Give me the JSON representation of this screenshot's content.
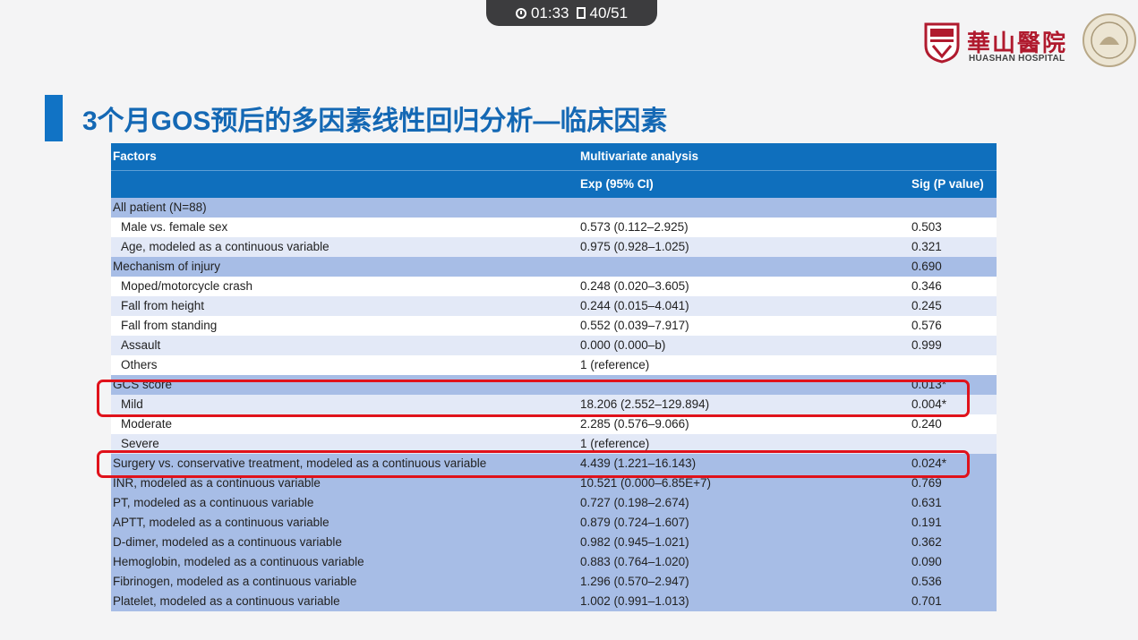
{
  "overlay": {
    "time": "01:33",
    "page": "40/51"
  },
  "logo": {
    "name_cn": "華山醫院",
    "name_en": "HUASHAN HOSPITAL"
  },
  "slide": {
    "title": "3个月GOS预后的多因素线性回归分析—临床因素"
  },
  "table": {
    "header": {
      "factors": "Factors",
      "group": "Multivariate analysis",
      "exp": "Exp (95% CI)",
      "sig": "Sig (P value)"
    },
    "rows": [
      {
        "factor": "All patient (N=88)",
        "exp": "",
        "sig": ""
      },
      {
        "factor": "Male vs. female sex",
        "exp": "0.573 (0.112–2.925)",
        "sig": "0.503"
      },
      {
        "factor": "Age, modeled as a continuous variable",
        "exp": "0.975 (0.928–1.025)",
        "sig": "0.321"
      },
      {
        "factor": "Mechanism of injury",
        "exp": "",
        "sig": "0.690"
      },
      {
        "factor": "Moped/motorcycle crash",
        "exp": "0.248 (0.020–3.605)",
        "sig": "0.346"
      },
      {
        "factor": "Fall from height",
        "exp": "0.244 (0.015–4.041)",
        "sig": "0.245"
      },
      {
        "factor": "Fall from standing",
        "exp": "0.552 (0.039–7.917)",
        "sig": "0.576"
      },
      {
        "factor": "Assault",
        "exp": "0.000 (0.000–b)",
        "sig": "0.999"
      },
      {
        "factor": "Others",
        "exp": "1 (reference)",
        "sig": ""
      },
      {
        "factor": "GCS score",
        "exp": "",
        "sig": "0.013*"
      },
      {
        "factor": "Mild",
        "exp": "18.206 (2.552–129.894)",
        "sig": "0.004*"
      },
      {
        "factor": "Moderate",
        "exp": "2.285 (0.576–9.066)",
        "sig": "0.240"
      },
      {
        "factor": "Severe",
        "exp": "1 (reference)",
        "sig": ""
      },
      {
        "factor": "Surgery vs. conservative treatment, modeled as a continuous variable",
        "exp": "4.439 (1.221–16.143)",
        "sig": "0.024*"
      },
      {
        "factor": "INR, modeled as a continuous variable",
        "exp": "10.521 (0.000–6.85E+7)",
        "sig": "0.769"
      },
      {
        "factor": "PT, modeled as a continuous variable",
        "exp": "0.727 (0.198–2.674)",
        "sig": "0.631"
      },
      {
        "factor": "APTT, modeled as a continuous variable",
        "exp": "0.879 (0.724–1.607)",
        "sig": "0.191"
      },
      {
        "factor": "D-dimer, modeled as a continuous variable",
        "exp": "0.982 (0.945–1.021)",
        "sig": "0.362"
      },
      {
        "factor": "Hemoglobin, modeled as a continuous variable",
        "exp": "0.883 (0.764–1.020)",
        "sig": "0.090"
      },
      {
        "factor": "Fibrinogen, modeled as a continuous variable",
        "exp": "1.296 (0.570–2.947)",
        "sig": "0.536"
      },
      {
        "factor": "Platelet, modeled as a continuous variable",
        "exp": "1.002 (0.991–1.013)",
        "sig": "0.701"
      }
    ]
  },
  "colors": {
    "header_bg": "#0f6fbd",
    "category_row_bg": "#a7bde6",
    "light_row_bg": "#e3e9f7",
    "highlight_border": "#e0121b",
    "title_color": "#1468b4"
  }
}
